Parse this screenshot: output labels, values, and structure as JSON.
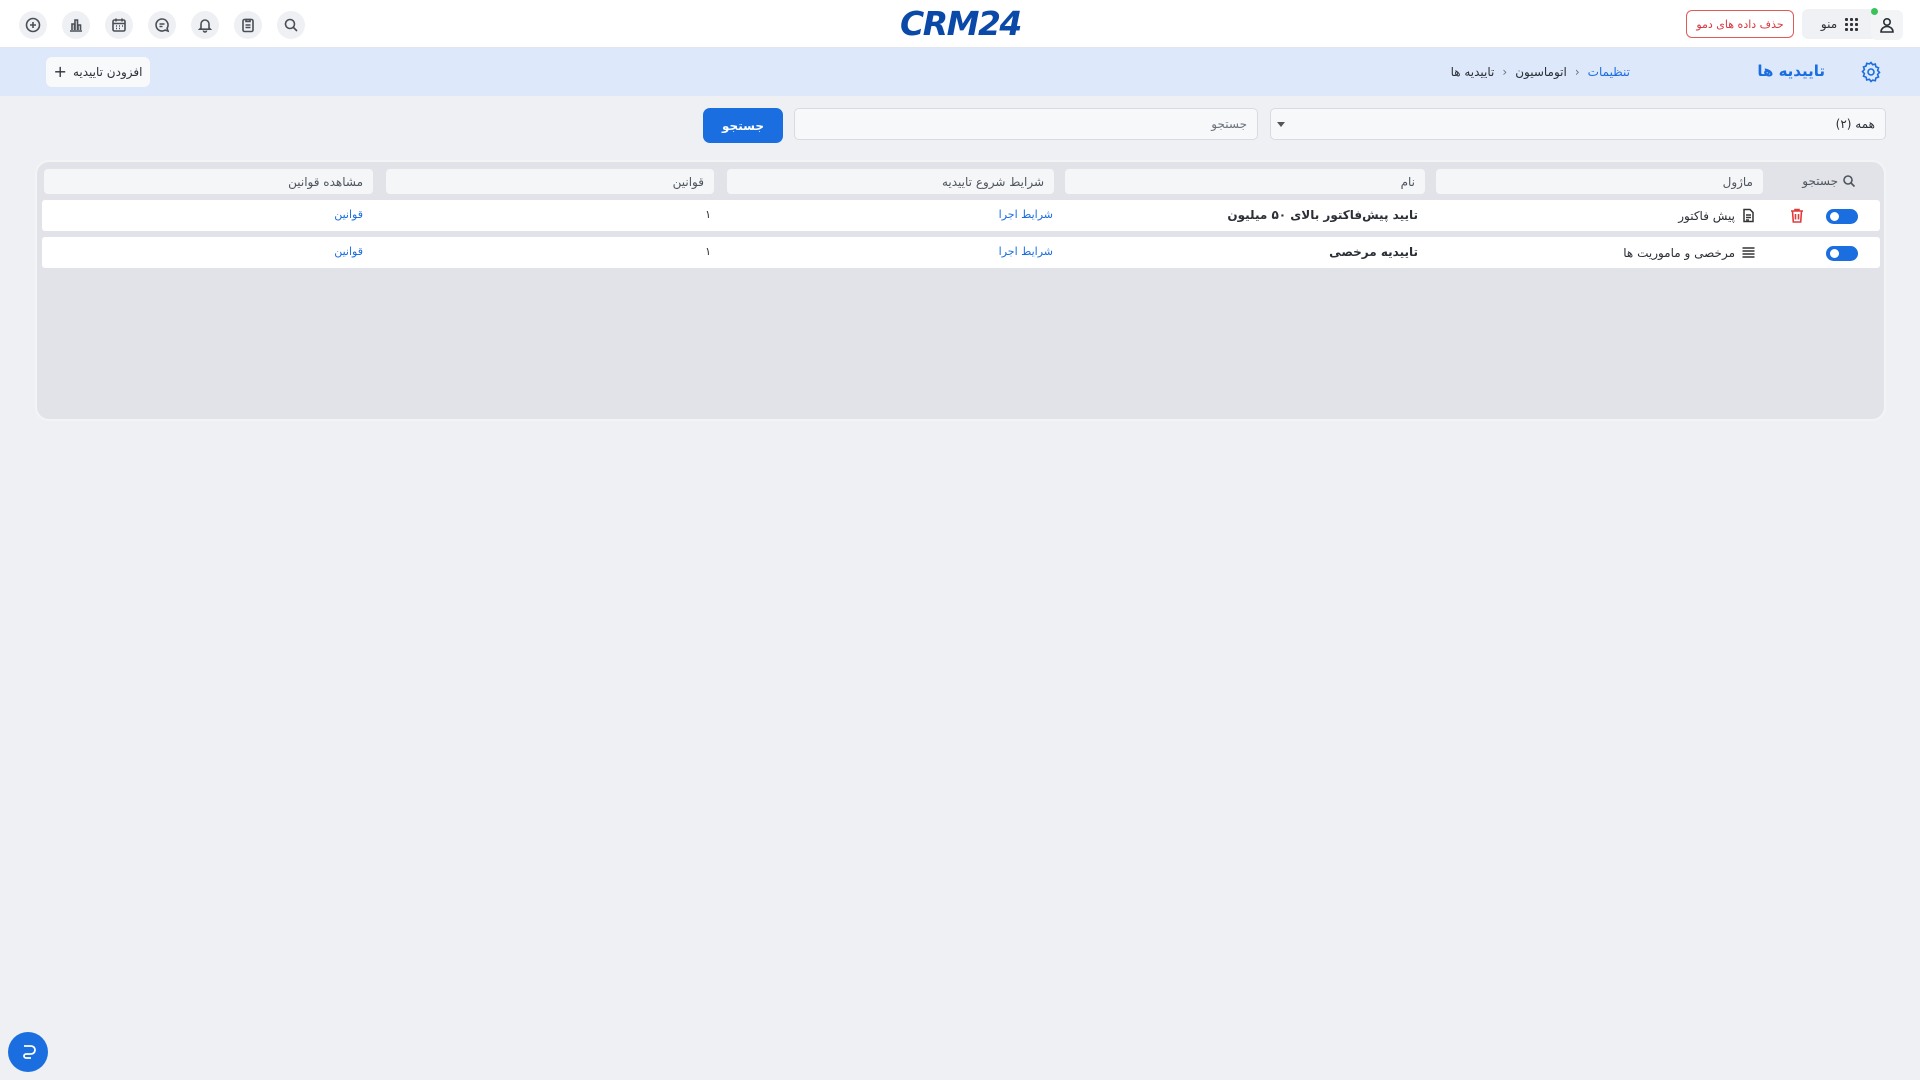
{
  "brand": {
    "logo_left": "CRM",
    "logo_right": "24"
  },
  "topbar": {
    "demo_button": "حذف داده های دمو",
    "menu_label": "منو",
    "icons": [
      "add-circle-icon",
      "chart-icon",
      "calendar-icon",
      "chat-icon",
      "bell-icon",
      "clipboard-icon",
      "search-icon"
    ]
  },
  "header": {
    "title": "تاییدیه ها",
    "breadcrumb": [
      "تنظیمات",
      "اتوماسیون",
      "تاییدیه ها"
    ],
    "add_button": "افزودن تاییدیه"
  },
  "filters": {
    "select_value": "همه (۲)",
    "search_placeholder": "جستجو",
    "search_button": "جستجو"
  },
  "table": {
    "search_label": "جستجو",
    "headers": {
      "module": "ماژول",
      "name": "نام",
      "conditions": "شرایط شروع تاییدیه",
      "rules": "قوانین",
      "view_rules": "مشاهده قوانین"
    },
    "rows": [
      {
        "enabled": true,
        "module": "پیش فاکتور",
        "module_icon": "invoice-icon",
        "name": "تایید پیش‌فاکتور بالای ۵۰ میلیون",
        "conditions": "شرایط اجرا",
        "rules": "۱",
        "view_rules": "قوانین",
        "deletable": true
      },
      {
        "enabled": true,
        "module": "مرخصی و ماموریت ها",
        "module_icon": "list-icon",
        "name": "تاییدیه مرخصی",
        "conditions": "شرایط اجرا",
        "rules": "۱",
        "view_rules": "قوانین",
        "deletable": false
      }
    ]
  },
  "colors": {
    "accent": "#1a6ee0",
    "danger": "#e03b3b",
    "band": "#dde8fb"
  }
}
